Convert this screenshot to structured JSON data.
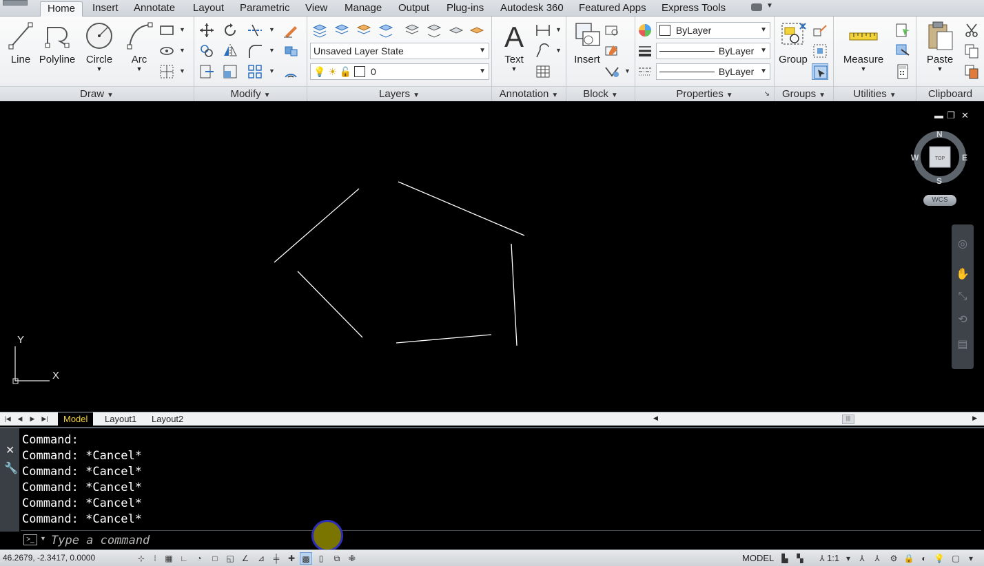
{
  "ribbon_tabs": [
    "Home",
    "Insert",
    "Annotate",
    "Layout",
    "Parametric",
    "View",
    "Manage",
    "Output",
    "Plug-ins",
    "Autodesk 360",
    "Featured Apps",
    "Express Tools"
  ],
  "active_tab": "Home",
  "panels": {
    "draw": {
      "title": "Draw",
      "line": "Line",
      "polyline": "Polyline",
      "circle": "Circle",
      "arc": "Arc"
    },
    "modify": {
      "title": "Modify"
    },
    "layers": {
      "title": "Layers",
      "layer_state": "Unsaved Layer State",
      "current_layer": "0"
    },
    "annotation": {
      "title": "Annotation",
      "text": "Text"
    },
    "block": {
      "title": "Block",
      "insert": "Insert"
    },
    "properties": {
      "title": "Properties",
      "color": "ByLayer",
      "linetype": "ByLayer",
      "lineweight": "ByLayer"
    },
    "groups": {
      "title": "Groups",
      "group": "Group"
    },
    "utilities": {
      "title": "Utilities",
      "measure": "Measure"
    },
    "clipboard": {
      "title": "Clipboard",
      "paste": "Paste"
    }
  },
  "viewcube": {
    "north": "N",
    "south": "S",
    "east": "E",
    "west": "W",
    "face": "TOP",
    "wcs": "WCS"
  },
  "ucs": {
    "x_label": "X",
    "y_label": "Y"
  },
  "layout_tabs": [
    "Model",
    "Layout1",
    "Layout2"
  ],
  "active_layout": "Model",
  "command_history": [
    "Command:",
    "Command: *Cancel*",
    "Command: *Cancel*",
    "Command: *Cancel*",
    "Command: *Cancel*",
    "Command: *Cancel*"
  ],
  "command_placeholder": "Type a command",
  "status": {
    "coordinates": "46.2679, -2.3417, 0.0000",
    "model_label": "MODEL",
    "annotation_scale": "1:1"
  },
  "colors": {
    "accent_layout_tab": "#f3d33a",
    "drawing_lines": "#ffffff",
    "canvas_bg": "#000000"
  }
}
